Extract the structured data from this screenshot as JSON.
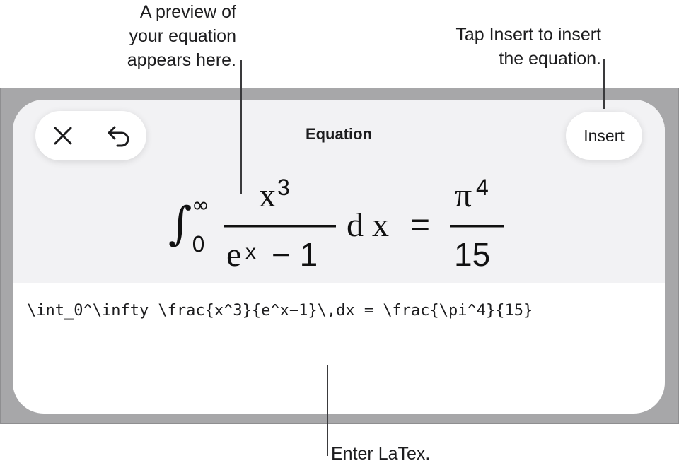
{
  "callouts": {
    "preview": "A preview of\nyour equation\nappears here.",
    "insert": "Tap Insert to insert\nthe equation.",
    "latex": "Enter LaTex."
  },
  "sheet": {
    "title": "Equation",
    "insert_label": "Insert",
    "close_icon": "close-icon",
    "undo_icon": "undo-icon"
  },
  "preview": {
    "integral": "∫",
    "lower_limit": "0",
    "upper_limit": "∞",
    "numerator_base": "x",
    "numerator_exp": "3",
    "denominator_base": "e",
    "denominator_exp": "x",
    "denominator_rest": "− 1",
    "differential": "d x",
    "equals": "=",
    "rhs_numerator_base": "π",
    "rhs_numerator_exp": "4",
    "rhs_denominator": "15"
  },
  "input": {
    "latex": "\\int_0^\\infty \\frac{x^3}{e^x−1}\\,dx = \\frac{\\pi^4}{15}"
  },
  "colors": {
    "backdrop": "#a7a7a9",
    "sheet": "#ffffff",
    "preview_area": "#f2f2f4",
    "text": "#1c1c1e"
  }
}
